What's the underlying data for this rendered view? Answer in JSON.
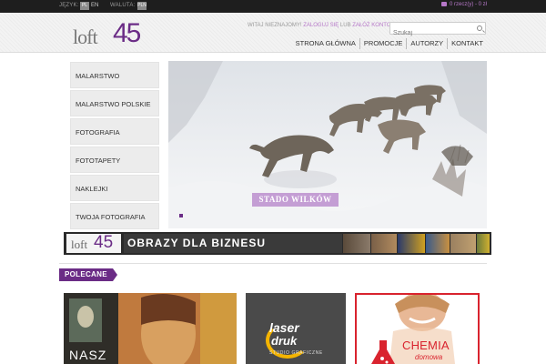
{
  "topbar": {
    "language_label": "JĘZYK:",
    "lang_pl": "PL",
    "lang_en": "EN",
    "currency_label": "WALUTA:",
    "currency_value": "PLN",
    "cart_text": "0 rzecz(y) - 0 zł"
  },
  "header": {
    "logo_text_1": "loft",
    "logo_text_2": "45",
    "welcome_text": "WITAJ NIEZNAJOMY!",
    "login_link": "ZALOGUJ SIĘ",
    "or_text": "LUB",
    "register_link": "ZAŁÓŻ KONTO",
    "search_placeholder": "Szukaj"
  },
  "nav": {
    "items": [
      "STRONA GŁÓWNA",
      "PROMOCJE",
      "AUTORZY",
      "KONTAKT"
    ]
  },
  "sidebar": {
    "items": [
      "MALARSTWO",
      "MALARSTWO POLSKIE",
      "FOTOGRAFIA",
      "FOTOTAPETY",
      "NAKLEJKI",
      "TWOJA FOTOGRAFIA"
    ]
  },
  "slider": {
    "caption": "STADO WILKÓW"
  },
  "banner": {
    "logo_text_1": "loft",
    "logo_text_2": "45",
    "text": "OBRAZY DLA BIZNESU"
  },
  "recommended": {
    "label": "POLECANE",
    "cards": [
      {
        "title": "NASZ"
      },
      {
        "line1": "laser",
        "line2": "druk",
        "line3": "STUDIO GRAFICZNE"
      },
      {
        "line1": "CHEMIA",
        "line2": "domowa"
      }
    ]
  },
  "colors": {
    "brand": "#6b2c86",
    "accent": "#b678c8",
    "topbar": "#1e1e1e"
  }
}
